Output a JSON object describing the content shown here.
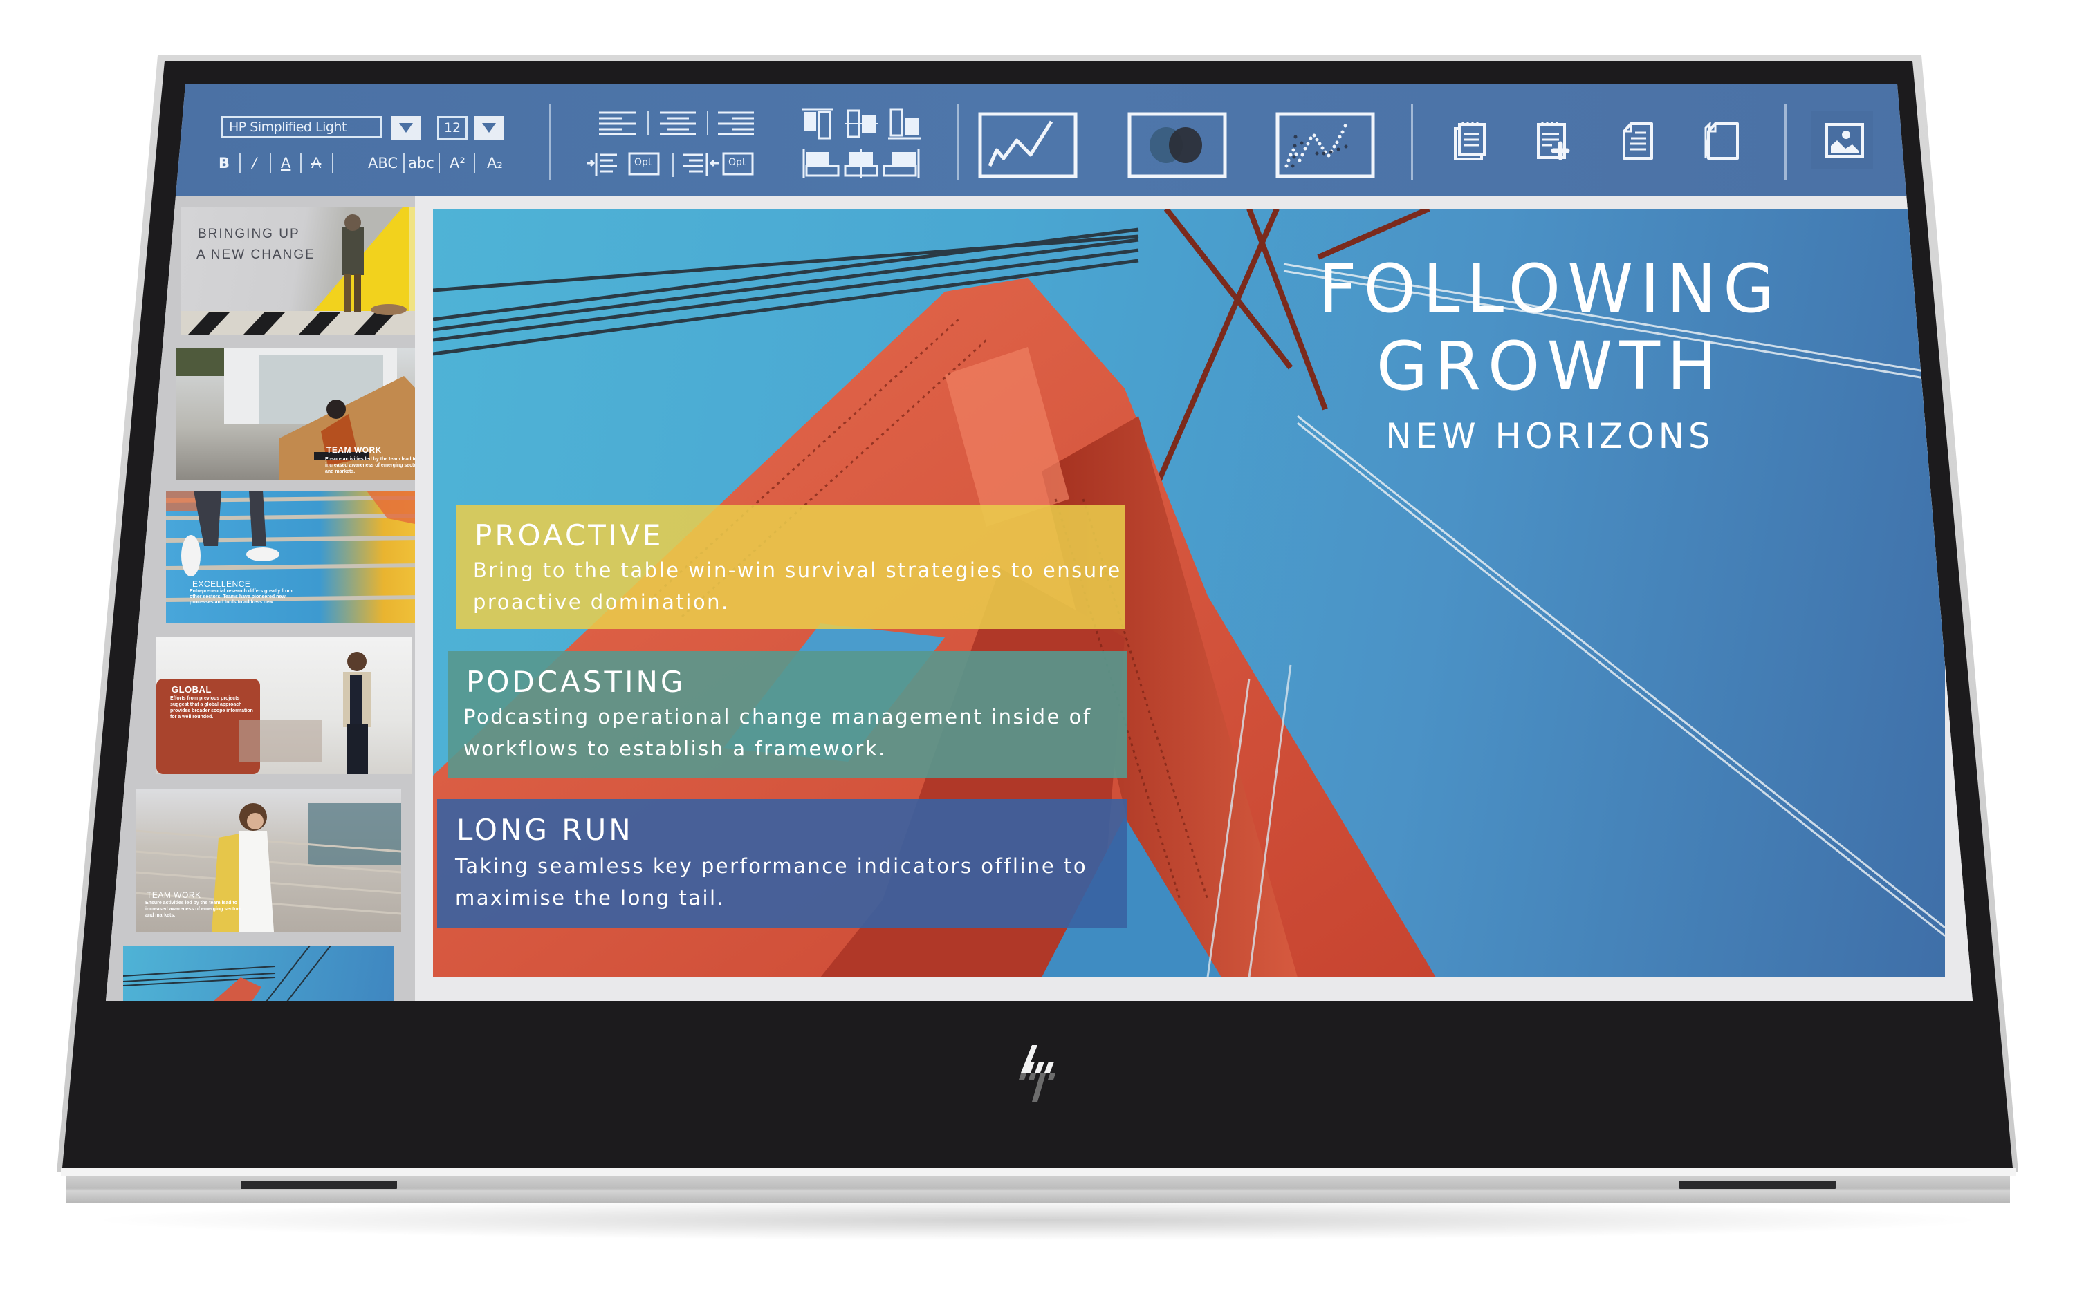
{
  "device": {
    "brand_logo": "hp"
  },
  "toolbar": {
    "font_family_value": "HP Simplified Light",
    "font_size_value": "12",
    "format_buttons": [
      {
        "label": "B",
        "name": "bold"
      },
      {
        "label": "/",
        "name": "italic"
      },
      {
        "label": "A",
        "name": "underline"
      },
      {
        "label": "A",
        "name": "strikethrough"
      }
    ],
    "case_buttons": [
      {
        "label": "ABC",
        "name": "uppercase"
      },
      {
        "label": "abc",
        "name": "lowercase"
      },
      {
        "label": "A²",
        "name": "superscript"
      },
      {
        "label": "A₂",
        "name": "subscript"
      }
    ],
    "indent_option_label": "Opt",
    "outdent_option_label": "Opt",
    "icons": {
      "align": [
        "align-left-icon",
        "align-center-icon",
        "align-right-icon"
      ],
      "indent": [
        "indent-left-icon",
        "indent-right-icon"
      ],
      "arrange_vertical": [
        "align-top-icon",
        "align-middle-icon",
        "align-bottom-icon"
      ],
      "arrange_horizontal": [
        "align-left-objects-icon",
        "align-center-objects-icon",
        "align-right-objects-icon"
      ],
      "charts": [
        "line-chart-icon",
        "venn-diagram-icon",
        "scatter-plot-icon"
      ],
      "pages": [
        "notes-icon",
        "add-note-icon",
        "document-icon",
        "duplicate-page-icon"
      ],
      "media": [
        "insert-image-icon"
      ]
    }
  },
  "thumbnails": [
    {
      "title_lines": [
        "BRINGING UP",
        "A NEW CHANGE"
      ],
      "body": ""
    },
    {
      "title": "TEAM WORK",
      "body": "Ensure activities led by the team lead to increased awareness of emerging sectors and markets."
    },
    {
      "title": "EXCELLENCE",
      "body": "Entrepreneurial research differs greatly from other sectors. Teams have pioneered new processes and tools to address new"
    },
    {
      "title": "GLOBAL",
      "body": "Efforts from previous projects suggest that a global approach provides broader scope information for a well rounded."
    },
    {
      "title": "TEAM WORK",
      "body": "Ensure activities led by the team lead to increased awareness of emerging sectors and markets."
    },
    {
      "title": "",
      "body": ""
    }
  ],
  "slide": {
    "title_line1": "FOLLOWING",
    "title_line2": "GROWTH",
    "subtitle": "NEW HORIZONS",
    "panels": [
      {
        "title": "PROACTIVE",
        "body": "Bring to the table win-win survival strategies to ensure\nproactive domination.",
        "color": "#e8c94c"
      },
      {
        "title": "PODCASTING",
        "body": "Podcasting operational change management inside of\nworkflows to establish a framework.",
        "color": "#5e9890"
      },
      {
        "title": "LONG RUN",
        "body": "Taking seamless key performance indicators offline to\nmaximise the long tail.",
        "color": "#3d67a3"
      }
    ]
  },
  "colors": {
    "toolbar_blue": "#4a70a3",
    "bezel": "#1c1b1d",
    "frame_silver": "#c9c9c9",
    "bridge_red": "#d8533e",
    "sky_blue": "#4aa7d2"
  }
}
